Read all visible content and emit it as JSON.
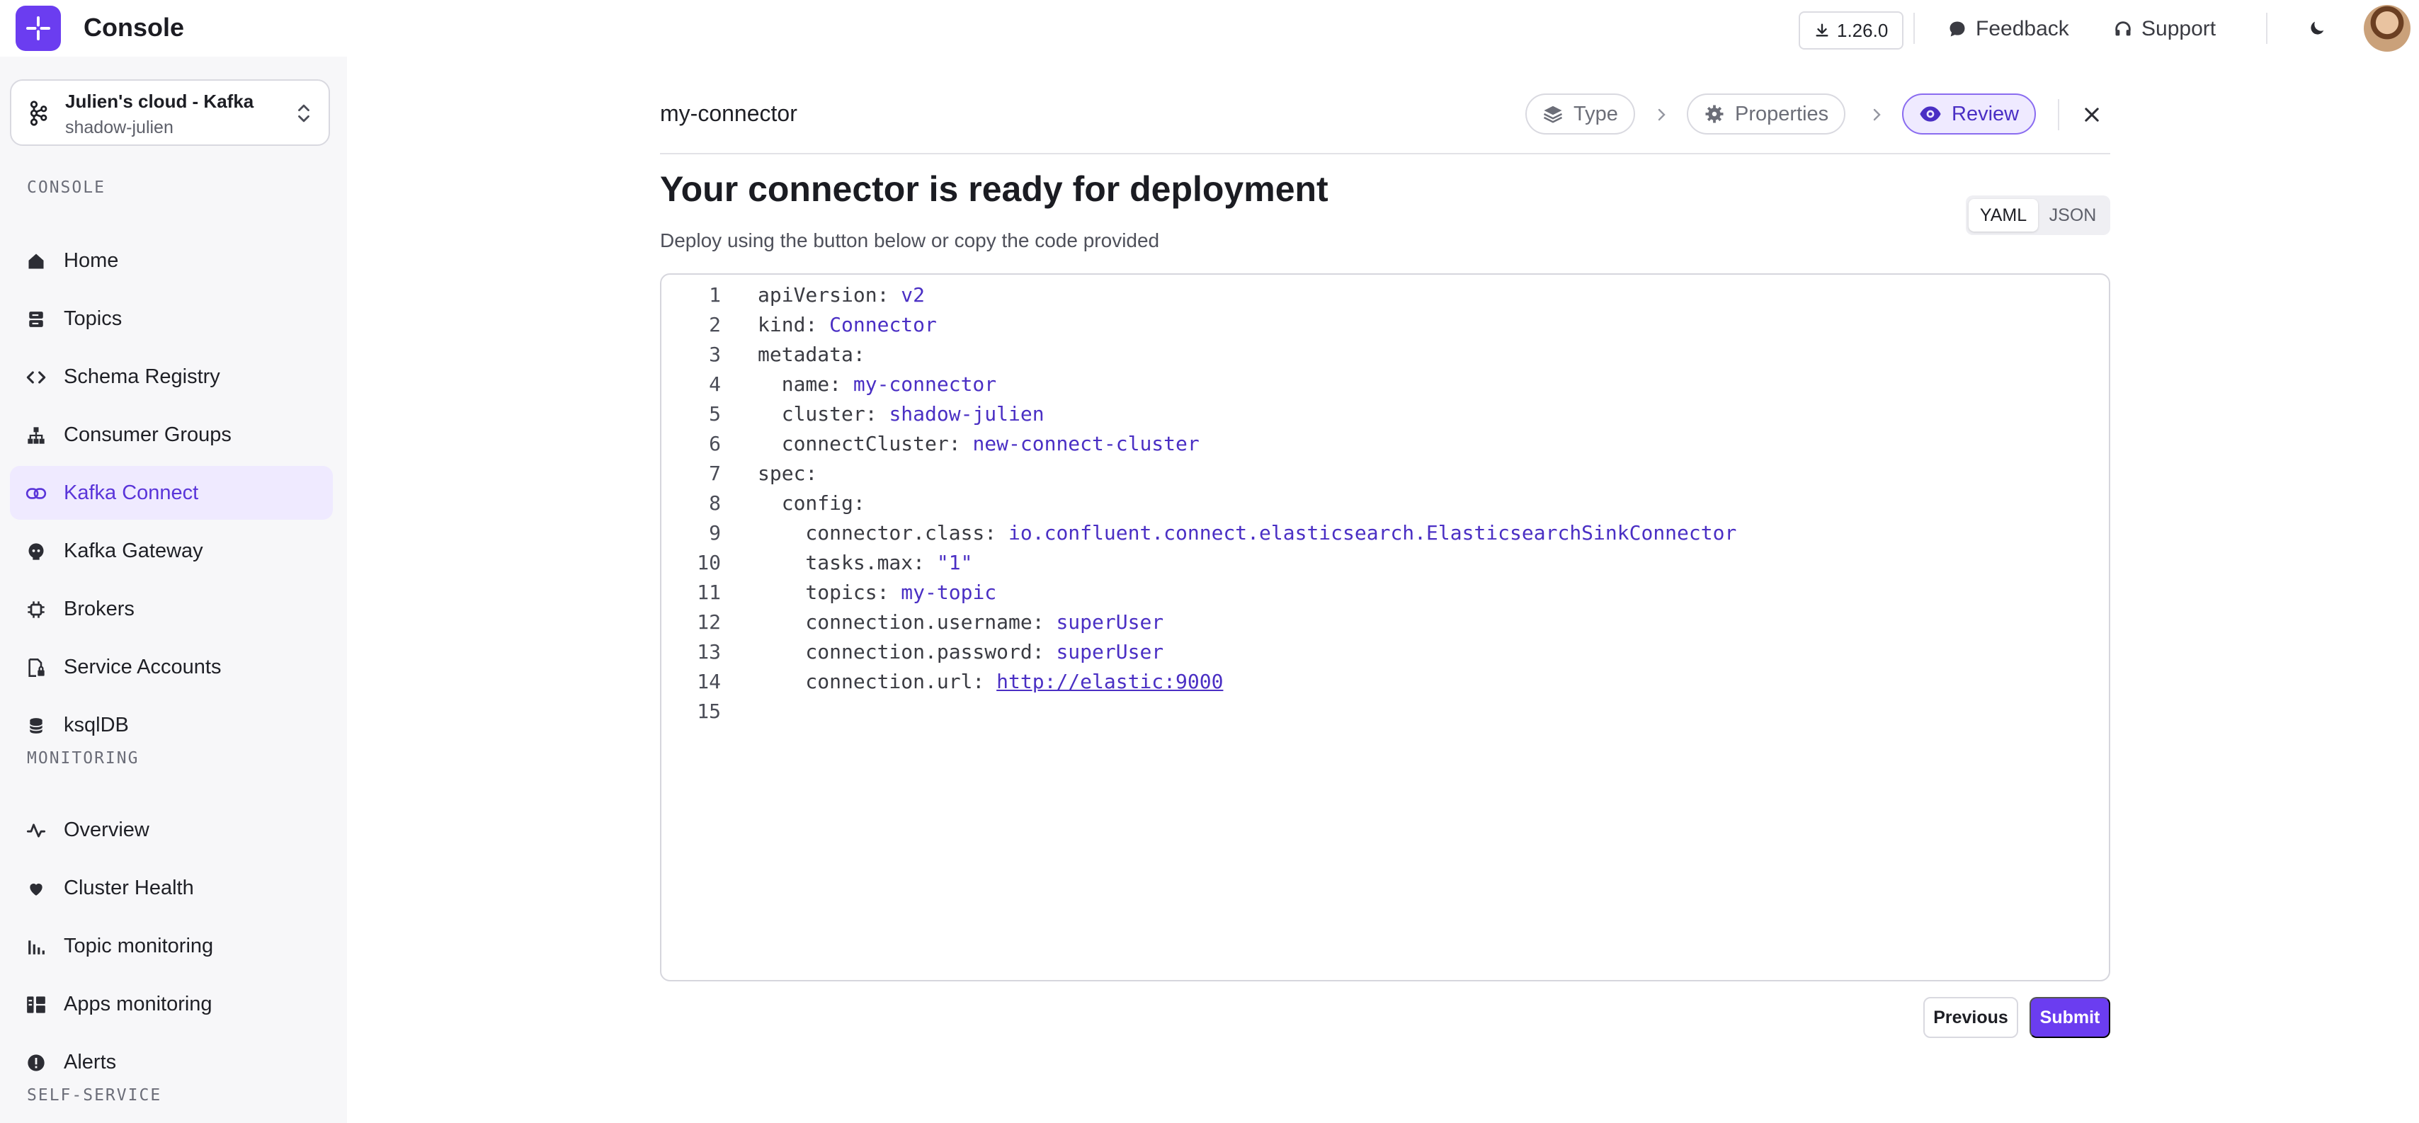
{
  "app": {
    "title": "Console",
    "version": "1.26.0"
  },
  "topbar": {
    "feedback": "Feedback",
    "support": "Support"
  },
  "cluster": {
    "name": "Julien's cloud - Kafka",
    "sub": "shadow-julien"
  },
  "sidebar": {
    "sections": [
      "CONSOLE",
      "MONITORING",
      "SELF-SERVICE"
    ],
    "console_items": [
      "Home",
      "Topics",
      "Schema Registry",
      "Consumer Groups",
      "Kafka Connect",
      "Kafka Gateway",
      "Brokers",
      "Service Accounts",
      "ksqlDB"
    ],
    "monitoring_items": [
      "Overview",
      "Cluster Health",
      "Topic monitoring",
      "Apps monitoring",
      "Alerts"
    ],
    "active": "Kafka Connect"
  },
  "wizard": {
    "connector_name": "my-connector",
    "steps": [
      "Type",
      "Properties",
      "Review"
    ],
    "active_step": "Review",
    "heading": "Your connector is ready for deployment",
    "subtext": "Deploy using the button below or copy the code provided",
    "formats": [
      "YAML",
      "JSON"
    ],
    "selected_format": "YAML",
    "previous": "Previous",
    "submit": "Submit"
  },
  "code_lines": [
    {
      "n": "1",
      "k": "apiVersion: ",
      "v": "v2"
    },
    {
      "n": "2",
      "k": "kind: ",
      "v": "Connector"
    },
    {
      "n": "3",
      "k": "metadata:",
      "v": ""
    },
    {
      "n": "4",
      "k": "  name: ",
      "v": "my-connector"
    },
    {
      "n": "5",
      "k": "  cluster: ",
      "v": "shadow-julien"
    },
    {
      "n": "6",
      "k": "  connectCluster: ",
      "v": "new-connect-cluster"
    },
    {
      "n": "7",
      "k": "spec:",
      "v": ""
    },
    {
      "n": "8",
      "k": "  config:",
      "v": ""
    },
    {
      "n": "9",
      "k": "    connector.class: ",
      "v": "io.confluent.connect.elasticsearch.ElasticsearchSinkConnector"
    },
    {
      "n": "10",
      "k": "    tasks.max: ",
      "v": "\"1\""
    },
    {
      "n": "11",
      "k": "    topics: ",
      "v": "my-topic"
    },
    {
      "n": "12",
      "k": "    connection.username: ",
      "v": "superUser"
    },
    {
      "n": "13",
      "k": "    connection.password: ",
      "v": "superUser"
    },
    {
      "n": "14",
      "k": "    connection.url: ",
      "v": "http://elastic:9000"
    },
    {
      "n": "15",
      "k": "",
      "v": ""
    }
  ],
  "colors": {
    "accent": "#6b3df0",
    "active_bg": "#efeaff",
    "code_value": "#4a2fc4"
  }
}
